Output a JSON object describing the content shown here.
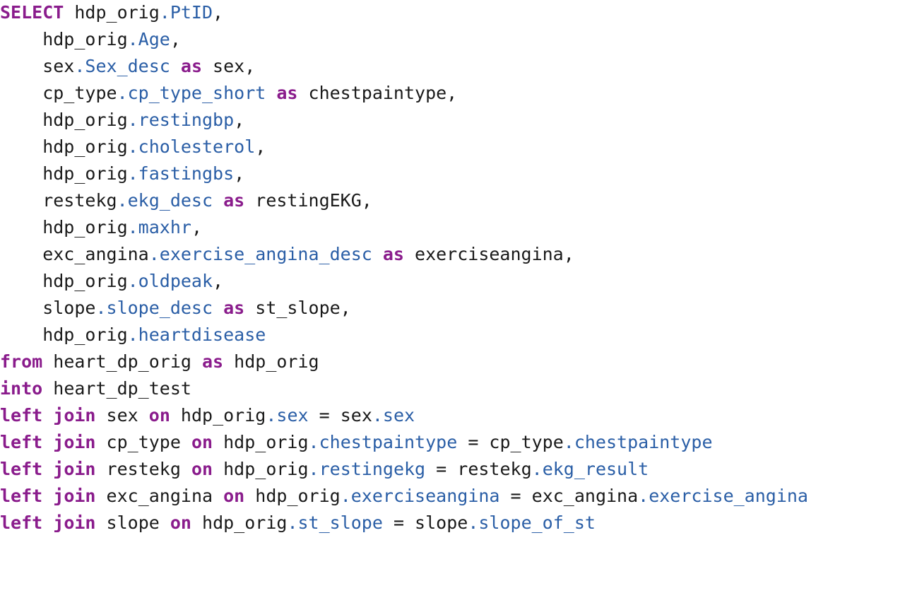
{
  "colors": {
    "keyword": "#8a1c8c",
    "field": "#2a5ea6",
    "text": "#1a1a1a",
    "background": "#ffffff"
  },
  "code_lines": [
    [
      {
        "t": "kw",
        "v": "SELECT"
      },
      {
        "t": "tx",
        "v": " hdp_orig"
      },
      {
        "t": "fld",
        "v": ".PtID"
      },
      {
        "t": "tx",
        "v": ","
      }
    ],
    [
      {
        "t": "tx",
        "v": "    hdp_orig"
      },
      {
        "t": "fld",
        "v": ".Age"
      },
      {
        "t": "tx",
        "v": ","
      }
    ],
    [
      {
        "t": "tx",
        "v": "    sex"
      },
      {
        "t": "fld",
        "v": ".Sex_desc"
      },
      {
        "t": "tx",
        "v": " "
      },
      {
        "t": "kw",
        "v": "as"
      },
      {
        "t": "tx",
        "v": " sex,"
      }
    ],
    [
      {
        "t": "tx",
        "v": "    cp_type"
      },
      {
        "t": "fld",
        "v": ".cp_type_short"
      },
      {
        "t": "tx",
        "v": " "
      },
      {
        "t": "kw",
        "v": "as"
      },
      {
        "t": "tx",
        "v": " chestpaintype,"
      }
    ],
    [
      {
        "t": "tx",
        "v": "    hdp_orig"
      },
      {
        "t": "fld",
        "v": ".restingbp"
      },
      {
        "t": "tx",
        "v": ","
      }
    ],
    [
      {
        "t": "tx",
        "v": "    hdp_orig"
      },
      {
        "t": "fld",
        "v": ".cholesterol"
      },
      {
        "t": "tx",
        "v": ","
      }
    ],
    [
      {
        "t": "tx",
        "v": "    hdp_orig"
      },
      {
        "t": "fld",
        "v": ".fastingbs"
      },
      {
        "t": "tx",
        "v": ","
      }
    ],
    [
      {
        "t": "tx",
        "v": "    restekg"
      },
      {
        "t": "fld",
        "v": ".ekg_desc"
      },
      {
        "t": "tx",
        "v": " "
      },
      {
        "t": "kw",
        "v": "as"
      },
      {
        "t": "tx",
        "v": " restingEKG,"
      }
    ],
    [
      {
        "t": "tx",
        "v": "    hdp_orig"
      },
      {
        "t": "fld",
        "v": ".maxhr"
      },
      {
        "t": "tx",
        "v": ","
      }
    ],
    [
      {
        "t": "tx",
        "v": "    exc_angina"
      },
      {
        "t": "fld",
        "v": ".exercise_angina_desc"
      },
      {
        "t": "tx",
        "v": " "
      },
      {
        "t": "kw",
        "v": "as"
      },
      {
        "t": "tx",
        "v": " exerciseangina,"
      }
    ],
    [
      {
        "t": "tx",
        "v": "    hdp_orig"
      },
      {
        "t": "fld",
        "v": ".oldpeak"
      },
      {
        "t": "tx",
        "v": ","
      }
    ],
    [
      {
        "t": "tx",
        "v": "    slope"
      },
      {
        "t": "fld",
        "v": ".slope_desc"
      },
      {
        "t": "tx",
        "v": " "
      },
      {
        "t": "kw",
        "v": "as"
      },
      {
        "t": "tx",
        "v": " st_slope,"
      }
    ],
    [
      {
        "t": "tx",
        "v": "    hdp_orig"
      },
      {
        "t": "fld",
        "v": ".heartdisease"
      }
    ],
    [
      {
        "t": "kw",
        "v": "from"
      },
      {
        "t": "tx",
        "v": " heart_dp_orig "
      },
      {
        "t": "kw",
        "v": "as"
      },
      {
        "t": "tx",
        "v": " hdp_orig"
      }
    ],
    [
      {
        "t": "kw",
        "v": "into"
      },
      {
        "t": "tx",
        "v": " heart_dp_test"
      }
    ],
    [
      {
        "t": "kw",
        "v": "left"
      },
      {
        "t": "tx",
        "v": " "
      },
      {
        "t": "kw",
        "v": "join"
      },
      {
        "t": "tx",
        "v": " sex "
      },
      {
        "t": "kw",
        "v": "on"
      },
      {
        "t": "tx",
        "v": " hdp_orig"
      },
      {
        "t": "fld",
        "v": ".sex"
      },
      {
        "t": "tx",
        "v": " = sex"
      },
      {
        "t": "fld",
        "v": ".sex"
      }
    ],
    [
      {
        "t": "kw",
        "v": "left"
      },
      {
        "t": "tx",
        "v": " "
      },
      {
        "t": "kw",
        "v": "join"
      },
      {
        "t": "tx",
        "v": " cp_type "
      },
      {
        "t": "kw",
        "v": "on"
      },
      {
        "t": "tx",
        "v": " hdp_orig"
      },
      {
        "t": "fld",
        "v": ".chestpaintype"
      },
      {
        "t": "tx",
        "v": " = cp_type"
      },
      {
        "t": "fld",
        "v": ".chestpaintype"
      }
    ],
    [
      {
        "t": "kw",
        "v": "left"
      },
      {
        "t": "tx",
        "v": " "
      },
      {
        "t": "kw",
        "v": "join"
      },
      {
        "t": "tx",
        "v": " restekg "
      },
      {
        "t": "kw",
        "v": "on"
      },
      {
        "t": "tx",
        "v": " hdp_orig"
      },
      {
        "t": "fld",
        "v": ".restingekg"
      },
      {
        "t": "tx",
        "v": " = restekg"
      },
      {
        "t": "fld",
        "v": ".ekg_result"
      }
    ],
    [
      {
        "t": "kw",
        "v": "left"
      },
      {
        "t": "tx",
        "v": " "
      },
      {
        "t": "kw",
        "v": "join"
      },
      {
        "t": "tx",
        "v": " exc_angina "
      },
      {
        "t": "kw",
        "v": "on"
      },
      {
        "t": "tx",
        "v": " hdp_orig"
      },
      {
        "t": "fld",
        "v": ".exerciseangina"
      },
      {
        "t": "tx",
        "v": " = exc_angina"
      },
      {
        "t": "fld",
        "v": ".exercise_angina"
      }
    ],
    [
      {
        "t": "kw",
        "v": "left"
      },
      {
        "t": "tx",
        "v": " "
      },
      {
        "t": "kw",
        "v": "join"
      },
      {
        "t": "tx",
        "v": " slope "
      },
      {
        "t": "kw",
        "v": "on"
      },
      {
        "t": "tx",
        "v": " hdp_orig"
      },
      {
        "t": "fld",
        "v": ".st_slope"
      },
      {
        "t": "tx",
        "v": " = slope"
      },
      {
        "t": "fld",
        "v": ".slope_of_st"
      }
    ]
  ]
}
